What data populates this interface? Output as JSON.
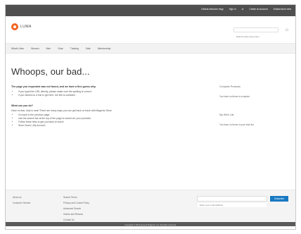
{
  "topbar": {
    "links": [
      "Default welcome msg!",
      "Sign In",
      "or",
      "Create an Account",
      "Default store view"
    ]
  },
  "header": {
    "logo_text": "LUMA",
    "search_placeholder": "Search entire store here...",
    "cart_icon": "cart-icon"
  },
  "nav": {
    "items": [
      "What's New",
      "Women",
      "Men",
      "Gear",
      "Training",
      "Sale",
      "Membership"
    ]
  },
  "main": {
    "title": "Whoops, our bad...",
    "lead": "The page you requested was not found, and we have a fine guess why.",
    "bullets_1": [
      "If you typed the URL directly, please make sure the spelling is correct.",
      "If you clicked on a link to get here, the link is outdated."
    ],
    "subhead": "What can you do?",
    "subtext": "Have no fear, help is near! There are many ways you can get back on track with Magento Store.",
    "bullets_2": [
      "Go back to the previous page.",
      "Use the search bar at the top of the page to search for your products.",
      "Follow these links to get you back on track!",
      "Store Home | My Account"
    ]
  },
  "sidebar": {
    "compare_title": "Compare Products",
    "compare_text": "You have no items to compare.",
    "wishlist_title": "My Wish List",
    "wishlist_text": "You have no items in your wish list."
  },
  "footer": {
    "col1": [
      "About us",
      "Customer Service"
    ],
    "col2": [
      "Search Terms",
      "Privacy and Cookie Policy",
      "Advanced Search",
      "Orders and Returns",
      "Contact Us"
    ],
    "newsletter_placeholder": "Enter your email address",
    "subscribe_label": "Subscribe",
    "copyright": "Copyright © 2013-present Magento, Inc. All rights reserved."
  },
  "colors": {
    "topbar": "#4f4f4f",
    "accent": "#1979c3",
    "logo": "#f26322"
  }
}
